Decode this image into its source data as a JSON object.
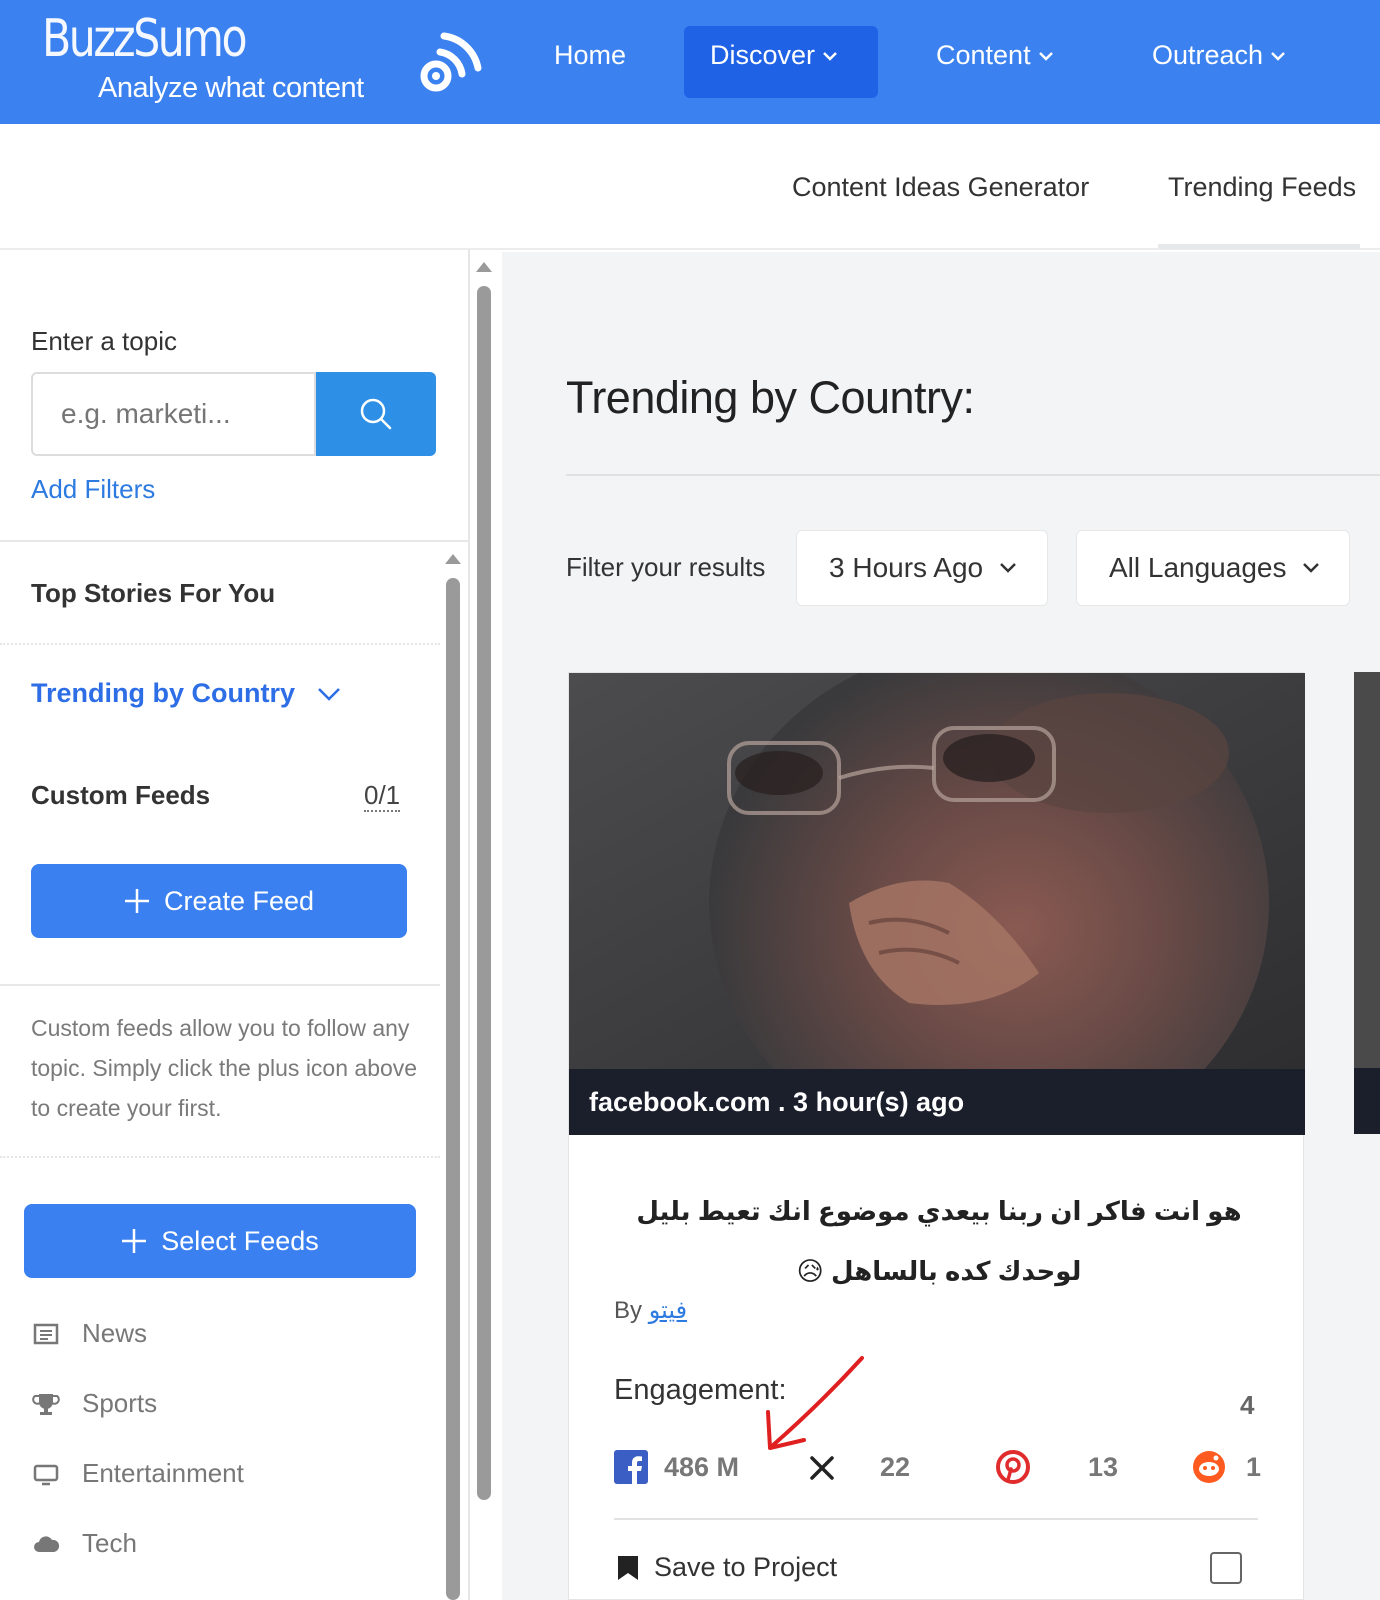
{
  "brand": {
    "name": "BuzzSumo",
    "tagline": "Analyze what content"
  },
  "nav": [
    {
      "label": "Home",
      "dropdown": false
    },
    {
      "label": "Discover",
      "dropdown": true,
      "active": true
    },
    {
      "label": "Content",
      "dropdown": true
    },
    {
      "label": "Outreach",
      "dropdown": true
    }
  ],
  "subnav": [
    {
      "label": "Content Ideas Generator"
    },
    {
      "label": "Trending Feeds",
      "active": true
    }
  ],
  "sidebar": {
    "topic_label": "Enter a topic",
    "search_placeholder": "e.g. marketi...",
    "add_filters": "Add Filters",
    "top_stories": "Top Stories For You",
    "trending_by_country": "Trending by Country",
    "custom_feeds": "Custom Feeds",
    "custom_feeds_count": "0/1",
    "create_feed": "Create Feed",
    "help_text": "Custom feeds allow you to follow any topic. Simply click the plus icon above to create your first.",
    "select_feeds": "Select Feeds",
    "categories": [
      {
        "label": "News",
        "icon": "newspaper-icon"
      },
      {
        "label": "Sports",
        "icon": "trophy-icon"
      },
      {
        "label": "Entertainment",
        "icon": "monitor-icon"
      },
      {
        "label": "Tech",
        "icon": "cloud-icon"
      }
    ]
  },
  "main": {
    "title": "Trending by Country:",
    "filter_label": "Filter your results",
    "time_filter": "3 Hours Ago",
    "language_filter": "All Languages"
  },
  "card": {
    "source": "facebook.com . 3 hour(s) ago",
    "title": "هو انت فاكر ان ربنا بيعدي موضوع انك تعيط بليل لوحدك كده بالساهل 😥",
    "by_label": "By",
    "author": "فيتو",
    "engagement_label": "Engagement:",
    "engagement_total": "4",
    "metrics": {
      "facebook": "486 M",
      "x": "22",
      "pinterest": "13",
      "reddit": "1"
    },
    "save_label": "Save to Project"
  },
  "colors": {
    "primary": "#3b82f0",
    "active_nav": "#1f62e6",
    "search_button": "#2d8fe6",
    "link": "#2d7ae0",
    "annotation": "#e02020"
  }
}
